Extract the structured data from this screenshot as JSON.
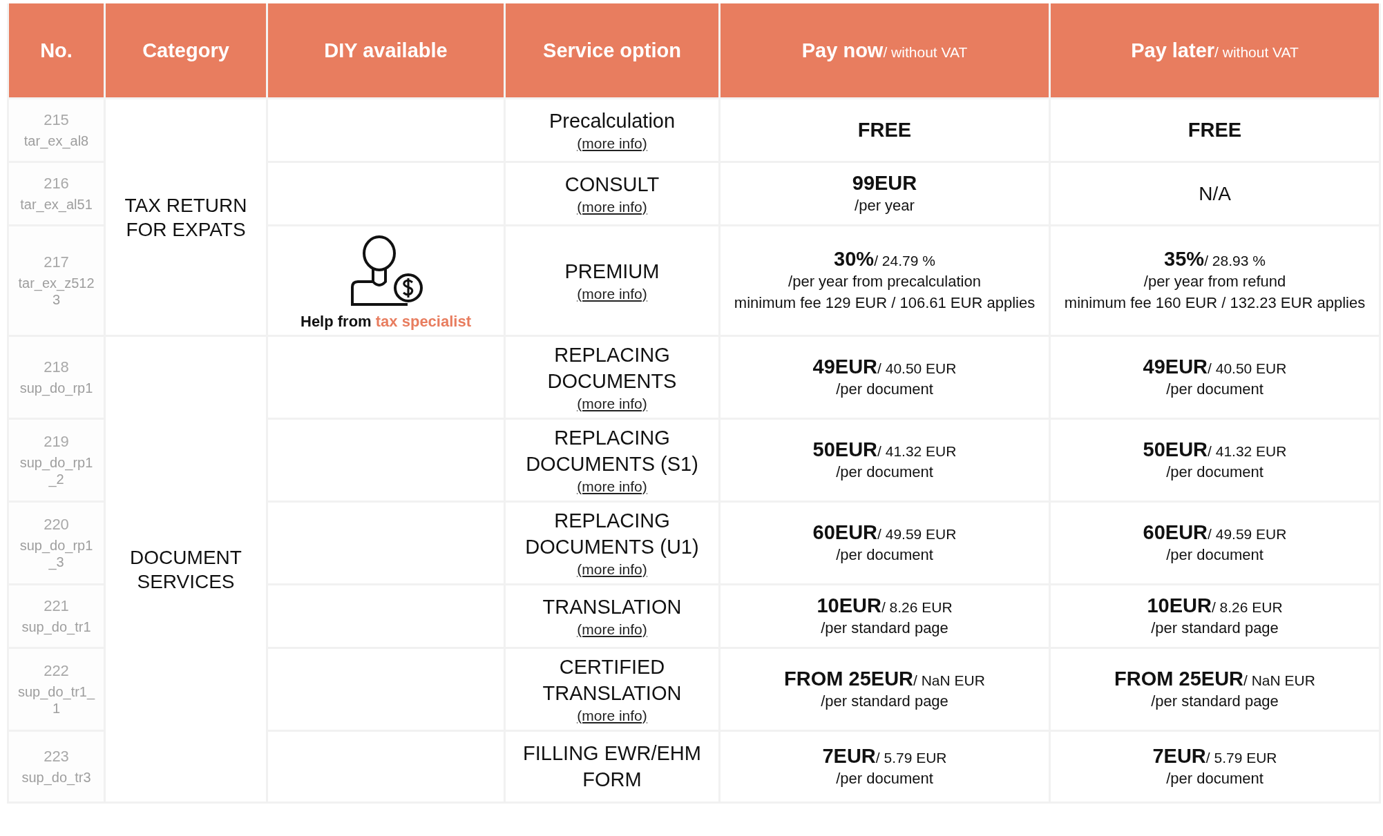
{
  "columns": [
    {
      "title": "No."
    },
    {
      "title": "Category"
    },
    {
      "title": "DIY available"
    },
    {
      "title": "Service option"
    },
    {
      "title": "Pay now",
      "subtitle": "/ without VAT"
    },
    {
      "title": "Pay later",
      "subtitle": "/ without VAT"
    }
  ],
  "categories": [
    {
      "name": "TAX RETURN FOR EXPATS",
      "rows": [
        {
          "no": "215",
          "code": "tar_ex_al8",
          "service": "Precalculation",
          "link": "(more info)",
          "pay_now": {
            "main": "FREE"
          },
          "pay_later": {
            "main": "FREE"
          }
        },
        {
          "no": "216",
          "code": "tar_ex_al51",
          "service": "CONSULT",
          "link": "(more info)",
          "pay_now": {
            "main": "99EUR",
            "lines": [
              "/per year"
            ]
          },
          "pay_later": {
            "plain": "N/A"
          }
        },
        {
          "no": "217",
          "code": "tar_ex_z512 3",
          "service": "PREMIUM",
          "link": "(more info)",
          "diy": {
            "text_before": "Help from",
            "highlight": "tax specialist"
          },
          "pay_now": {
            "main": "30%",
            "secondary": "/ 24.79 %",
            "lines": [
              "/per year from precalculation",
              "minimum fee 129 EUR / 106.61 EUR applies"
            ]
          },
          "pay_later": {
            "main": "35%",
            "secondary": "/ 28.93 %",
            "lines": [
              "/per year from refund",
              "minimum fee 160 EUR / 132.23 EUR applies"
            ]
          }
        }
      ]
    },
    {
      "name": "DOCUMENT SERVICES",
      "rows": [
        {
          "no": "218",
          "code": "sup_do_rp1",
          "service": "REPLACING DOCUMENTS",
          "link": "(more info)",
          "pay_now": {
            "main": "49EUR",
            "secondary": "/ 40.50 EUR",
            "lines": [
              "/per document"
            ]
          },
          "pay_later": {
            "main": "49EUR",
            "secondary": "/ 40.50 EUR",
            "lines": [
              "/per document"
            ]
          }
        },
        {
          "no": "219",
          "code": "sup_do_rp1 _2",
          "service": "REPLACING DOCUMENTS (S1)",
          "link": "(more info)",
          "pay_now": {
            "main": "50EUR",
            "secondary": "/ 41.32 EUR",
            "lines": [
              "/per document"
            ]
          },
          "pay_later": {
            "main": "50EUR",
            "secondary": "/ 41.32 EUR",
            "lines": [
              "/per document"
            ]
          }
        },
        {
          "no": "220",
          "code": "sup_do_rp1 _3",
          "service": "REPLACING DOCUMENTS (U1)",
          "link": "(more info)",
          "pay_now": {
            "main": "60EUR",
            "secondary": "/ 49.59 EUR",
            "lines": [
              "/per document"
            ]
          },
          "pay_later": {
            "main": "60EUR",
            "secondary": "/ 49.59 EUR",
            "lines": [
              "/per document"
            ]
          }
        },
        {
          "no": "221",
          "code": "sup_do_tr1",
          "service": "TRANSLATION",
          "link": "(more info)",
          "pay_now": {
            "main": "10EUR",
            "secondary": "/ 8.26 EUR",
            "lines": [
              "/per standard page"
            ]
          },
          "pay_later": {
            "main": "10EUR",
            "secondary": "/ 8.26 EUR",
            "lines": [
              "/per standard page"
            ]
          }
        },
        {
          "no": "222",
          "code": "sup_do_tr1_ 1",
          "service": "CERTIFIED TRANSLATION",
          "link": "(more info)",
          "pay_now": {
            "main": "FROM 25EUR",
            "secondary": "/ NaN EUR",
            "lines": [
              "/per standard page"
            ]
          },
          "pay_later": {
            "main": "FROM 25EUR",
            "secondary": "/ NaN EUR",
            "lines": [
              "/per standard page"
            ]
          }
        },
        {
          "no": "223",
          "code": "sup_do_tr3",
          "service": "FILLING EWR/EHM FORM",
          "pay_now": {
            "main": "7EUR",
            "secondary": "/ 5.79 EUR",
            "lines": [
              "/per document"
            ]
          },
          "pay_later": {
            "main": "7EUR",
            "secondary": "/ 5.79 EUR",
            "lines": [
              "/per document"
            ]
          }
        }
      ]
    }
  ]
}
